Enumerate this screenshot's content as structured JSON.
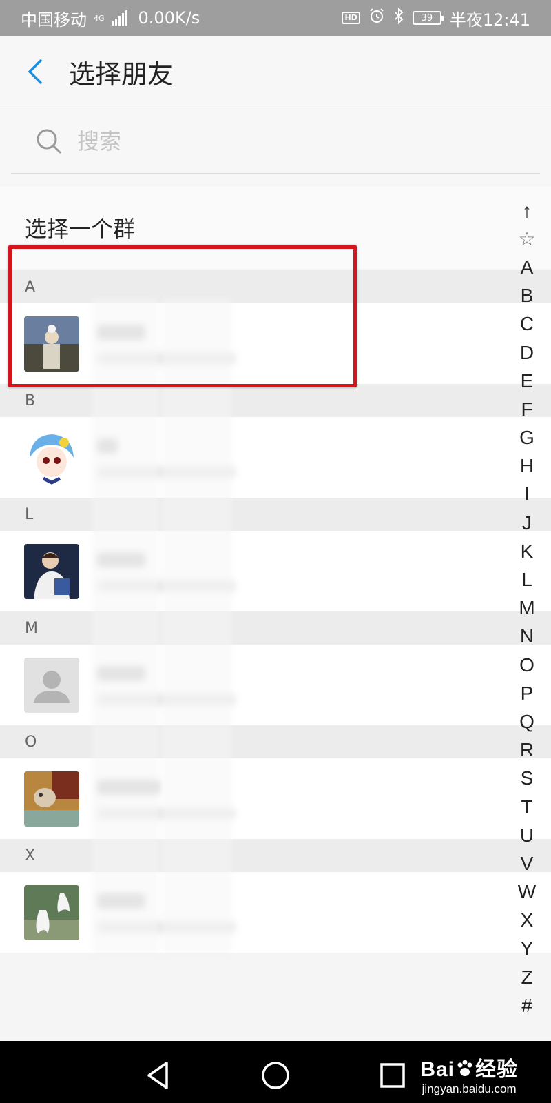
{
  "status_bar": {
    "carrier": "中国移动",
    "network": "4G",
    "speed": "0.00K/s",
    "hd_label": "HD",
    "battery": "39",
    "time": "半夜12:41"
  },
  "header": {
    "title": "选择朋友",
    "back_icon": "chevron-left-icon"
  },
  "search": {
    "placeholder": "搜索",
    "icon": "search-icon"
  },
  "group_entry": {
    "label": "选择一个群"
  },
  "sections": [
    {
      "letter": "A"
    },
    {
      "letter": "B"
    },
    {
      "letter": "L"
    },
    {
      "letter": "M"
    },
    {
      "letter": "O"
    },
    {
      "letter": "X"
    }
  ],
  "index_bar": [
    "↑",
    "☆",
    "A",
    "B",
    "C",
    "D",
    "E",
    "F",
    "G",
    "H",
    "I",
    "J",
    "K",
    "L",
    "M",
    "N",
    "O",
    "P",
    "Q",
    "R",
    "S",
    "T",
    "U",
    "V",
    "W",
    "X",
    "Y",
    "Z",
    "#"
  ],
  "watermark": {
    "brand": "Bai",
    "brand_suffix": "经验",
    "url": "jingyan.baidu.com"
  },
  "colors": {
    "accent": "#1a8ee1",
    "highlight": "#d6141d",
    "section_bg": "#ececec",
    "status_bar": "#9e9e9e"
  }
}
